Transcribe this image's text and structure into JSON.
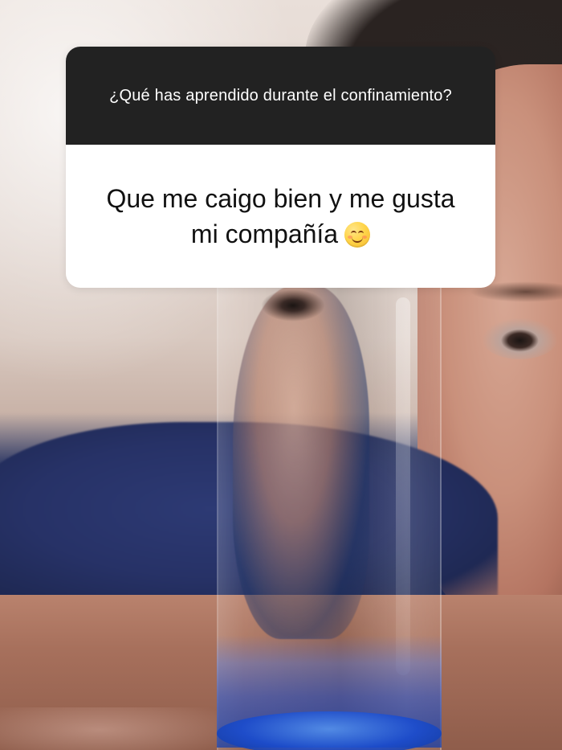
{
  "question_card": {
    "question": "¿Qué has aprendido durante el confinamiento?",
    "answer": "Que me caigo bien y me gusta mi compañía",
    "answer_emoji_icon": "smiling-face-with-smiling-eyes-icon"
  },
  "colors": {
    "header_bg": "#222222",
    "header_text": "#FFFFFF",
    "body_bg": "#FFFFFF",
    "body_text": "#111111"
  }
}
